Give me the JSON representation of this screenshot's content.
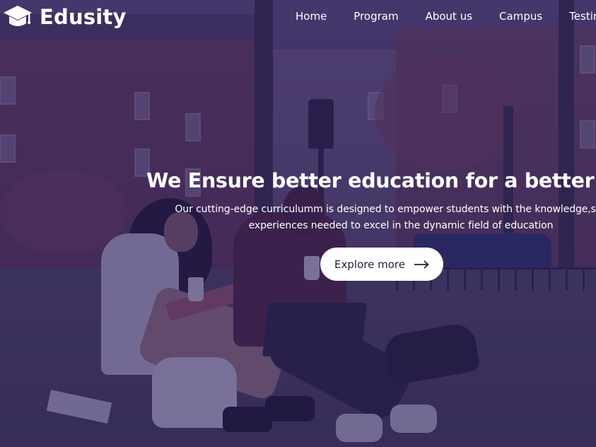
{
  "header": {
    "brand": "Edusity",
    "logo_icon": "graduation-cap-icon",
    "nav": [
      {
        "label": "Home"
      },
      {
        "label": "Program"
      },
      {
        "label": "About us"
      },
      {
        "label": "Campus"
      },
      {
        "label": "Testin"
      }
    ]
  },
  "hero": {
    "title": "We Ensure better education for a better wor",
    "subtitle_line1": "Our cutting-edge curriculumm is designed to empower students with the knowledge,skills, a",
    "subtitle_line2": "experiences needed to excel in the dynamic field of education",
    "cta_label": "Explore more",
    "cta_icon": "arrow-right-icon"
  },
  "colors": {
    "overlay": "#281c5c",
    "text": "#ffffff",
    "button_bg": "#ffffff",
    "button_text": "#212336"
  }
}
